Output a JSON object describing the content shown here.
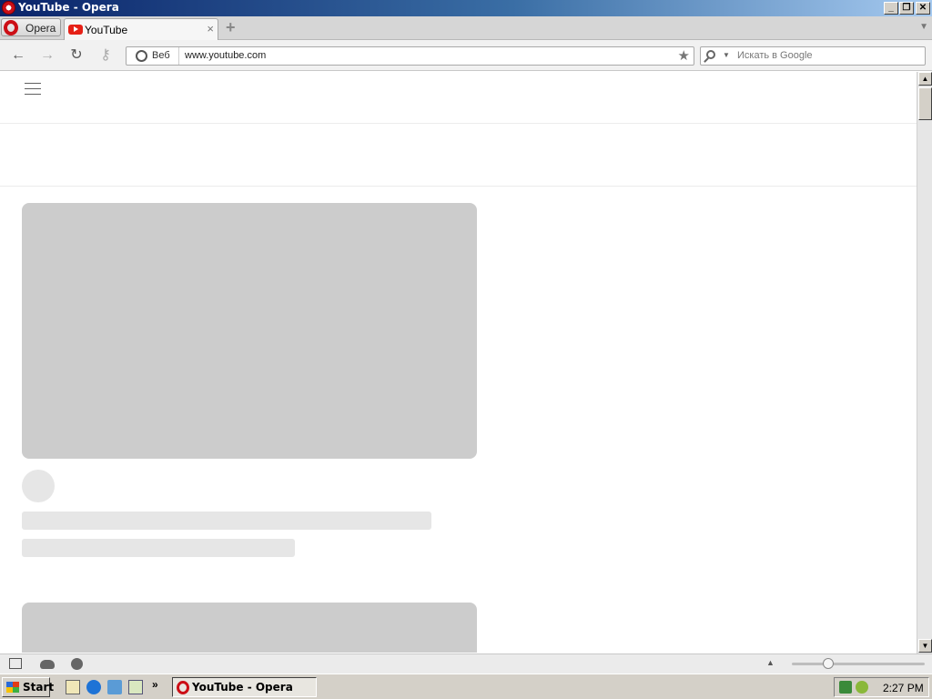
{
  "window": {
    "title": "YouTube - Opera",
    "controls": [
      "minimize",
      "maximize",
      "close"
    ]
  },
  "tabs": {
    "menu_label": "Opera",
    "active_tab": {
      "label": "YouTube",
      "favicon": "youtube-icon"
    },
    "close_icon": "close-icon",
    "new_tab_icon": "plus-icon"
  },
  "navbar": {
    "back_icon": "back-arrow-icon",
    "forward_icon": "forward-arrow-icon",
    "reload_icon": "reload-icon",
    "key_icon": "key-icon",
    "address": {
      "badge_icon": "globe-icon",
      "badge_label": "Веб",
      "url": "www.youtube.com",
      "bookmark_icon": "star-icon"
    },
    "search": {
      "icon": "search-icon",
      "placeholder": "Искать в Google"
    }
  },
  "page": {
    "menu_icon": "hamburger-icon",
    "placeholders": {
      "thumbnail_color": "#cccccc",
      "line_color": "#e6e6e6"
    }
  },
  "statusbar": {
    "icons": [
      "panel-toggle-icon",
      "cloud-icon",
      "speed-dial-icon"
    ],
    "zoom_icon": "zoom-up-icon"
  },
  "taskbar": {
    "start_label": "Start",
    "quick_launch": [
      "show-desktop-icon",
      "internet-explorer-icon",
      "outlook-express-icon",
      "search-icon"
    ],
    "overflow_label": "»",
    "active_task": "YouTube - Opera",
    "tray_icons": [
      "network-icon",
      "security-icon"
    ],
    "clock": "2:27 PM"
  },
  "colors": {
    "titlebar_start": "#0a246a",
    "titlebar_end": "#a6caf0",
    "opera_red": "#cc0f16",
    "youtube_red": "#e62117",
    "taskbar": "#d4d0c8"
  }
}
